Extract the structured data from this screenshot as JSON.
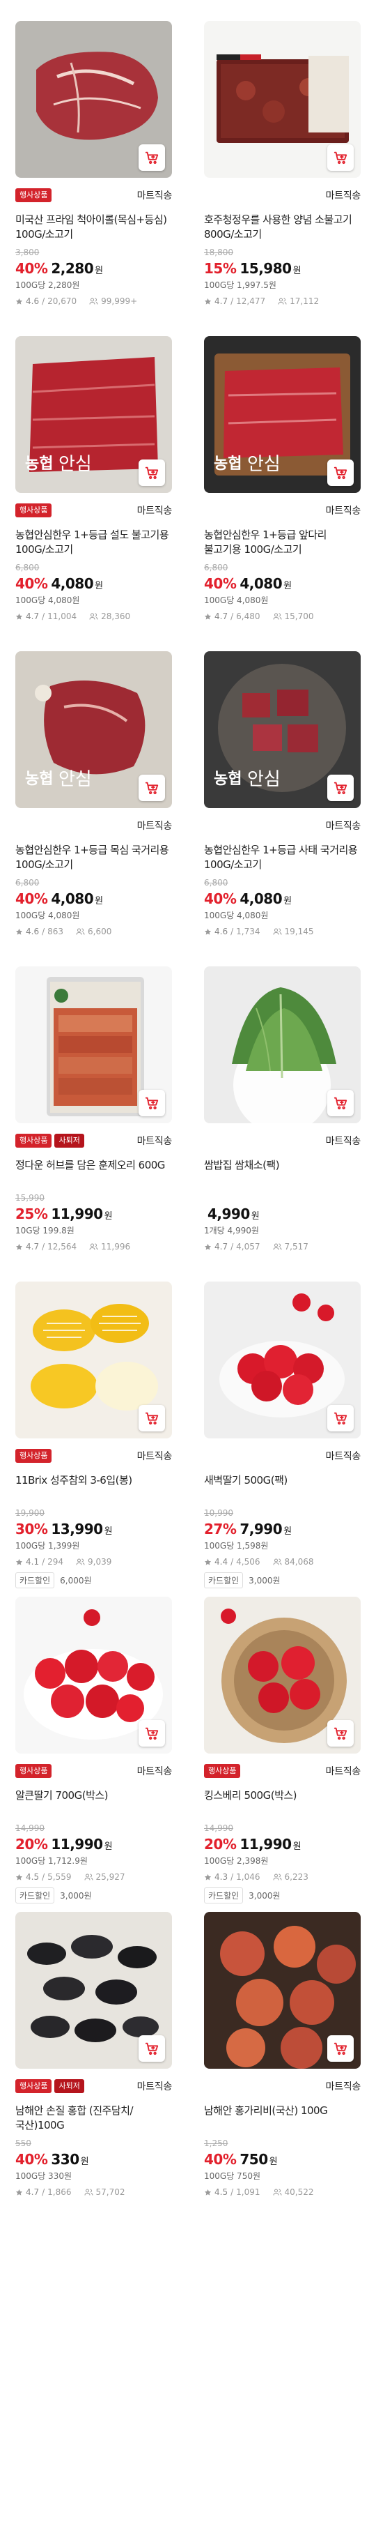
{
  "products": [
    {
      "badges": [
        "행사상품"
      ],
      "ship": "마트직송",
      "name": "미국산 프라임 척아이롤(목심+등심) 100G/소고기",
      "orig": "3,800",
      "disc": "40%",
      "price": "2,280",
      "won": "원",
      "unit": "100G당 2,280원",
      "rating": "4.6",
      "reviews": "20,670",
      "buyers": "99,999+",
      "tag": null,
      "img": "beef-steak"
    },
    {
      "badges": [],
      "ship": "마트직송",
      "name": "호주청정우를 사용한 양념 소불고기 800G/소고기",
      "orig": "18,800",
      "disc": "15%",
      "price": "15,980",
      "won": "원",
      "unit": "100G당 1,997.5원",
      "rating": "4.7",
      "reviews": "12,477",
      "buyers": "17,112",
      "tag": null,
      "img": "bulgogi-pack"
    },
    {
      "badges": [
        "행사상품"
      ],
      "ship": "마트직송",
      "name": "농협안심한우 1+등급 설도 불고기용 100G/소고기",
      "orig": "6,800",
      "disc": "40%",
      "price": "4,080",
      "won": "원",
      "unit": "100G당 4,080원",
      "rating": "4.7",
      "reviews": "11,004",
      "buyers": "28,360",
      "tag": null,
      "img": "beef-slices"
    },
    {
      "badges": [],
      "ship": "마트직송",
      "name": "농협안심한우 1+등급 앞다리 불고기용 100G/소고기",
      "orig": "6,800",
      "disc": "40%",
      "price": "4,080",
      "won": "원",
      "unit": "100G당 4,080원",
      "rating": "4.7",
      "reviews": "6,480",
      "buyers": "15,700",
      "tag": null,
      "img": "beef-slices-board"
    },
    {
      "badges": [],
      "ship": "마트직송",
      "name": "농협안심한우 1+등급 목심 국거리용 100G/소고기",
      "orig": "6,800",
      "disc": "40%",
      "price": "4,080",
      "won": "원",
      "unit": "100G당 4,080원",
      "rating": "4.6",
      "reviews": "863",
      "buyers": "6,600",
      "tag": null,
      "img": "beef-chunk"
    },
    {
      "badges": [],
      "ship": "마트직송",
      "name": "농협안심한우 1+등급 사태 국거리용 100G/소고기",
      "orig": "6,800",
      "disc": "40%",
      "price": "4,080",
      "won": "원",
      "unit": "100G당 4,080원",
      "rating": "4.6",
      "reviews": "1,734",
      "buyers": "19,145",
      "tag": null,
      "img": "beef-cubes"
    },
    {
      "badges": [
        "행사상품",
        "사퇴저"
      ],
      "ship": "마트직송",
      "name": "정다운 허브를 담은 훈제오리 600G",
      "orig": "15,990",
      "disc": "25%",
      "price": "11,990",
      "won": "원",
      "unit": "10G당 199.8원",
      "rating": "4.7",
      "reviews": "12,564",
      "buyers": "11,996",
      "tag": null,
      "img": "duck-pack"
    },
    {
      "badges": [],
      "ship": "마트직송",
      "name": "쌈밥집 쌈채소(팩)",
      "orig": "",
      "disc": "",
      "price": "4,990",
      "won": "원",
      "unit": "1개당 4,990원",
      "rating": "4.7",
      "reviews": "4,057",
      "buyers": "7,517",
      "tag": null,
      "img": "lettuce"
    },
    {
      "badges": [
        "행사상품"
      ],
      "ship": "마트직송",
      "name": "11Brix 성주참외 3-6입(봉)",
      "orig": "19,900",
      "disc": "30%",
      "price": "13,990",
      "won": "원",
      "unit": "100G당 1,399원",
      "rating": "4.1",
      "reviews": "294",
      "buyers": "9,039",
      "tag": {
        "label": "카드할인",
        "value": "6,000원"
      },
      "img": "melon"
    },
    {
      "badges": [],
      "ship": "마트직송",
      "name": "새벽딸기 500G(팩)",
      "orig": "10,990",
      "disc": "27%",
      "price": "7,990",
      "won": "원",
      "unit": "100G당 1,598원",
      "rating": "4.4",
      "reviews": "4,506",
      "buyers": "84,068",
      "tag": {
        "label": "카드할인",
        "value": "3,000원"
      },
      "img": "strawberry-bowl"
    },
    {
      "badges": [
        "행사상품"
      ],
      "ship": "마트직송",
      "name": "알큰딸기 700G(박스)",
      "orig": "14,990",
      "disc": "20%",
      "price": "11,990",
      "won": "원",
      "unit": "100G당 1,712.9원",
      "rating": "4.5",
      "reviews": "5,559",
      "buyers": "25,927",
      "tag": {
        "label": "카드할인",
        "value": "3,000원"
      },
      "img": "strawberry-white"
    },
    {
      "badges": [
        "행사상품"
      ],
      "ship": "마트직송",
      "name": "킹스베리 500G(박스)",
      "orig": "14,990",
      "disc": "20%",
      "price": "11,990",
      "won": "원",
      "unit": "100G당 2,398원",
      "rating": "4.3",
      "reviews": "1,046",
      "buyers": "6,223",
      "tag": {
        "label": "카드할인",
        "value": "3,000원"
      },
      "img": "strawberry-basket"
    },
    {
      "badges": [
        "행사상품",
        "사퇴저"
      ],
      "ship": "마트직송",
      "name": "남해안 손질 홍합 (진주담치/국산)100G",
      "orig": "550",
      "disc": "40%",
      "price": "330",
      "won": "원",
      "unit": "100G당 330원",
      "rating": "4.7",
      "reviews": "1,866",
      "buyers": "57,702",
      "tag": null,
      "img": "mussels"
    },
    {
      "badges": [],
      "ship": "마트직송",
      "name": "남해안 홍가리비(국산) 100G",
      "orig": "1,250",
      "disc": "40%",
      "price": "750",
      "won": "원",
      "unit": "100G당 750원",
      "rating": "4.5",
      "reviews": "1,091",
      "buyers": "40,522",
      "tag": null,
      "img": "scallops"
    }
  ],
  "brand_watermark": "농협안심",
  "colors": {
    "accent": "#e2202c",
    "badge": "#d3232b"
  }
}
